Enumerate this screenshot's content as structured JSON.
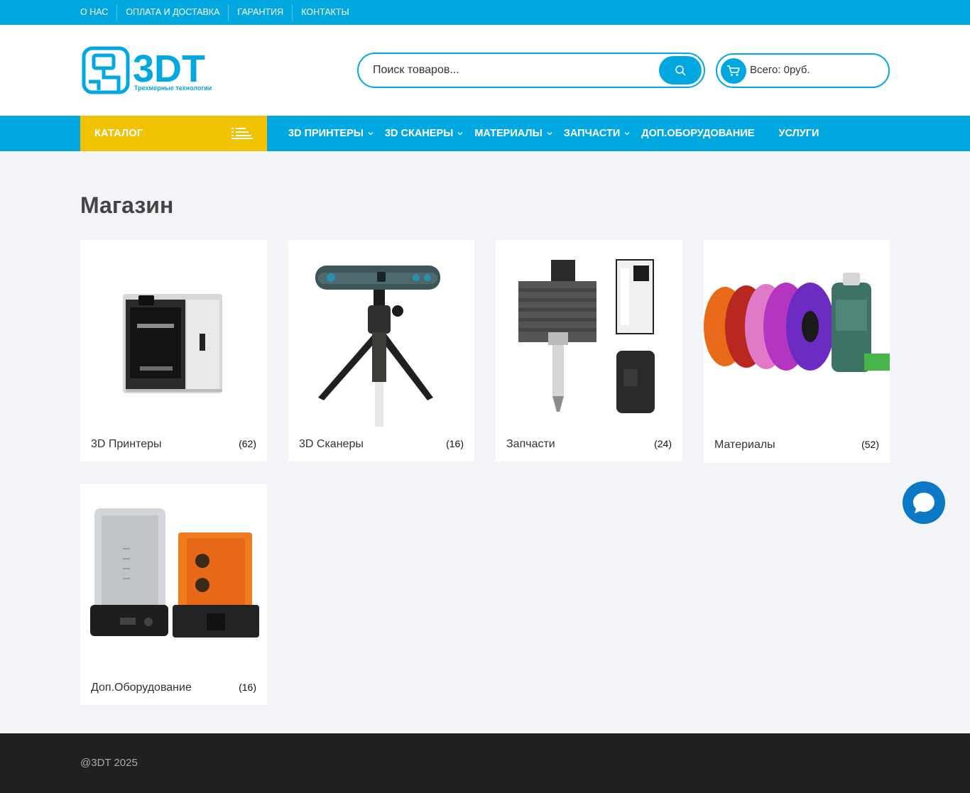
{
  "topnav": [
    "О НАС",
    "ОПЛАТА И ДОСТАВКА",
    "ГАРАНТИЯ",
    "КОНТАКТЫ"
  ],
  "logo": {
    "text": "3DT",
    "tagline": "Трехмерные технологии"
  },
  "search": {
    "placeholder": "Поиск товаров..."
  },
  "cart": {
    "label": "Всего: 0руб."
  },
  "catalog": {
    "label": "КАТАЛОГ"
  },
  "menu": [
    "3D ПРИНТЕРЫ",
    "3D СКАНЕРЫ",
    "МАТЕРИАЛЫ",
    "ЗАПЧАСТИ",
    "ДОП.ОБОРУДОВАНИЕ",
    "УСЛУГИ"
  ],
  "page": {
    "title": "Магазин"
  },
  "categories": [
    {
      "name": "3D Принтеры",
      "count": "(62)"
    },
    {
      "name": "3D Сканеры",
      "count": "(16)"
    },
    {
      "name": "Запчасти",
      "count": "(24)"
    },
    {
      "name": "Материалы",
      "count": "(52)"
    },
    {
      "name": "Доп.Оборудование",
      "count": "(16)"
    }
  ],
  "footer": {
    "copyright": "@3DT 2025"
  },
  "colors": {
    "primary": "#01a8df",
    "catalog": "#f0c200",
    "footer": "#202020",
    "chat": "#0a78c4"
  }
}
